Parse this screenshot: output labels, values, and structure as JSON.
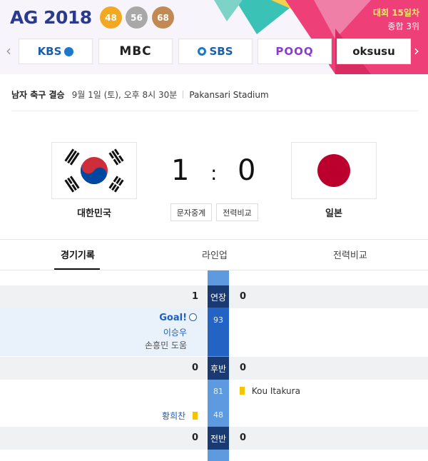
{
  "header": {
    "logo": "AG 2018",
    "medals": {
      "gold": "48",
      "silver": "56",
      "bronze": "68"
    },
    "day_label": "대회 15일차",
    "rank_label": "종합 3위"
  },
  "broadcasters": [
    "KBS",
    "MBC",
    "SBS",
    "POOQ",
    "oksusu"
  ],
  "match": {
    "category": "남자 축구 결승",
    "datetime": "9월 1일 (토), 오후 8시 30분",
    "venue": "Pakansari Stadium",
    "home_team": "대한민국",
    "away_team": "일본",
    "home_score": "1",
    "away_score": "0",
    "separator": ":",
    "buttons": [
      "문자중계",
      "전력비교"
    ]
  },
  "tabs": [
    "경기기록",
    "라인업",
    "전력비교"
  ],
  "timeline": {
    "extra_time": {
      "label": "연장",
      "home": "1",
      "away": "0"
    },
    "goal": {
      "title": "Goal!",
      "minute": "93",
      "scorer": "이승우",
      "assist": "손흥민 도움"
    },
    "second_half": {
      "label": "후반",
      "home": "0",
      "away": "0"
    },
    "card_away": {
      "minute": "81",
      "player": "Kou Itakura"
    },
    "card_home": {
      "minute": "48",
      "player": "황희찬"
    },
    "first_half": {
      "label": "전반",
      "home": "0",
      "away": "0"
    }
  },
  "colors": {
    "brand": "#2a3a8c",
    "timeline_dark": "#1a3a74",
    "timeline_light": "#5d9ae0",
    "goal": "#2363c4",
    "yellow_card": "#f5c400"
  }
}
